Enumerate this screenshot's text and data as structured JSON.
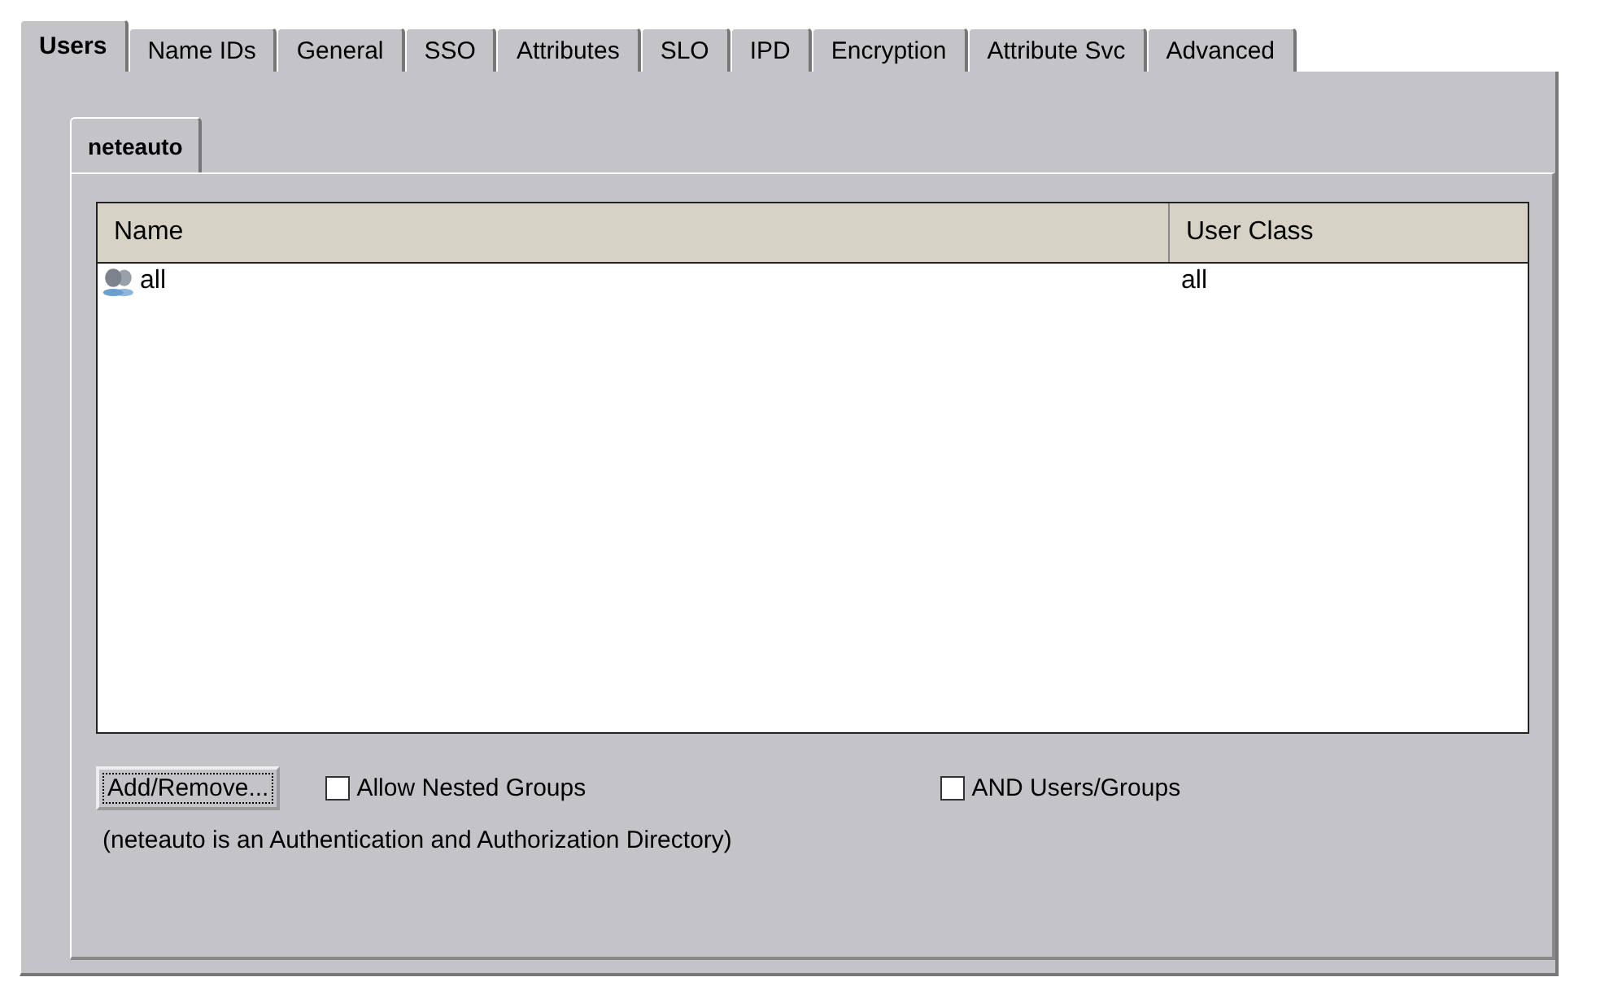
{
  "tabs": [
    {
      "label": "Users",
      "selected": true
    },
    {
      "label": "Name IDs",
      "selected": false
    },
    {
      "label": "General",
      "selected": false
    },
    {
      "label": "SSO",
      "selected": false
    },
    {
      "label": "Attributes",
      "selected": false
    },
    {
      "label": "SLO",
      "selected": false
    },
    {
      "label": "IPD",
      "selected": false
    },
    {
      "label": "Encryption",
      "selected": false
    },
    {
      "label": "Attribute Svc",
      "selected": false
    },
    {
      "label": "Advanced",
      "selected": false
    }
  ],
  "sub_tabs": [
    {
      "label": "neteauto",
      "selected": true
    }
  ],
  "table": {
    "columns": [
      "Name",
      "User Class"
    ],
    "rows": [
      {
        "name": "all",
        "kind": "group",
        "user_class": "all"
      }
    ]
  },
  "buttons": [
    "Add/Remove..."
  ],
  "options": [
    {
      "label": "Allow Nested Groups",
      "checked": false
    },
    {
      "label": "AND Users/Groups",
      "checked": false
    }
  ],
  "note": "(neteauto is an Authentication and Authorization Directory)"
}
